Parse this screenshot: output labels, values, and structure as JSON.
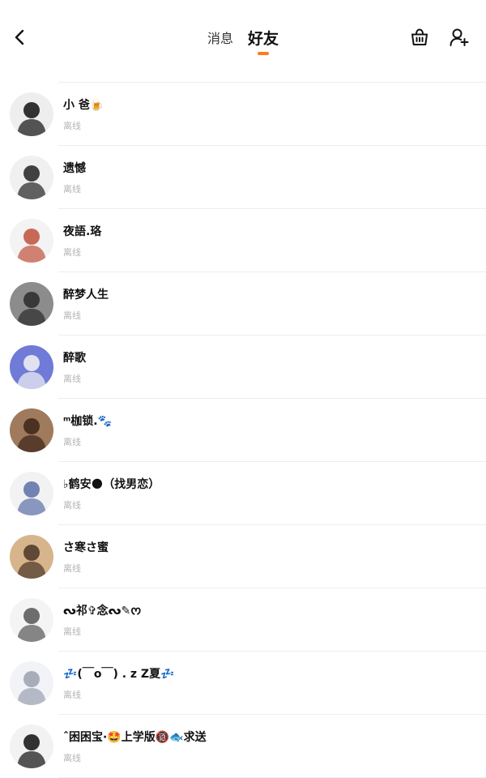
{
  "header": {
    "tabs": [
      {
        "label": "消息",
        "active": false
      },
      {
        "label": "好友",
        "active": true
      }
    ],
    "accent_color": "#ff7a1a"
  },
  "friends": [
    {
      "name": "",
      "status": "离线",
      "avatar_colors": [
        "#e7e7e7",
        "#d4c9a8"
      ]
    },
    {
      "name": "小 爸🍺",
      "status": "离线",
      "avatar_colors": [
        "#eeeeee",
        "#111111"
      ]
    },
    {
      "name": "遗憾",
      "status": "离线",
      "avatar_colors": [
        "#f0f0f0",
        "#222222"
      ]
    },
    {
      "name": "夜語.珞",
      "status": "离线",
      "avatar_colors": [
        "#f3f3f3",
        "#c0503a"
      ]
    },
    {
      "name": "醉梦人生",
      "status": "离线",
      "avatar_colors": [
        "#8c8c8c",
        "#2a2a2a"
      ]
    },
    {
      "name": "醉歌",
      "status": "离线",
      "avatar_colors": [
        "#6f7bd6",
        "#f4f4f4"
      ]
    },
    {
      "name": "ᵐ枷锁.🐾",
      "status": "离线",
      "avatar_colors": [
        "#a07a5c",
        "#3b2418"
      ]
    },
    {
      "name": "♭鹤安🌑（找男恋）",
      "status": "离线",
      "avatar_colors": [
        "#f2f2f2",
        "#5c6fa8"
      ]
    },
    {
      "name": "さ寒さ蜜",
      "status": "离线",
      "avatar_colors": [
        "#d7b58c",
        "#4a3526"
      ]
    },
    {
      "name": "ᔓ祁✞念ᔓ✎ᰔ",
      "status": "离线",
      "avatar_colors": [
        "#f4f4f4",
        "#555555"
      ]
    },
    {
      "name": "💤(￣o￣) . z Z夏💤",
      "status": "离线",
      "avatar_colors": [
        "#f2f3f7",
        "#9aa0b0"
      ]
    },
    {
      "name": "ˆ困困宝·🤩上学版🔞🐟求送",
      "status": "离线",
      "avatar_colors": [
        "#f2f2f2",
        "#111111"
      ]
    }
  ]
}
